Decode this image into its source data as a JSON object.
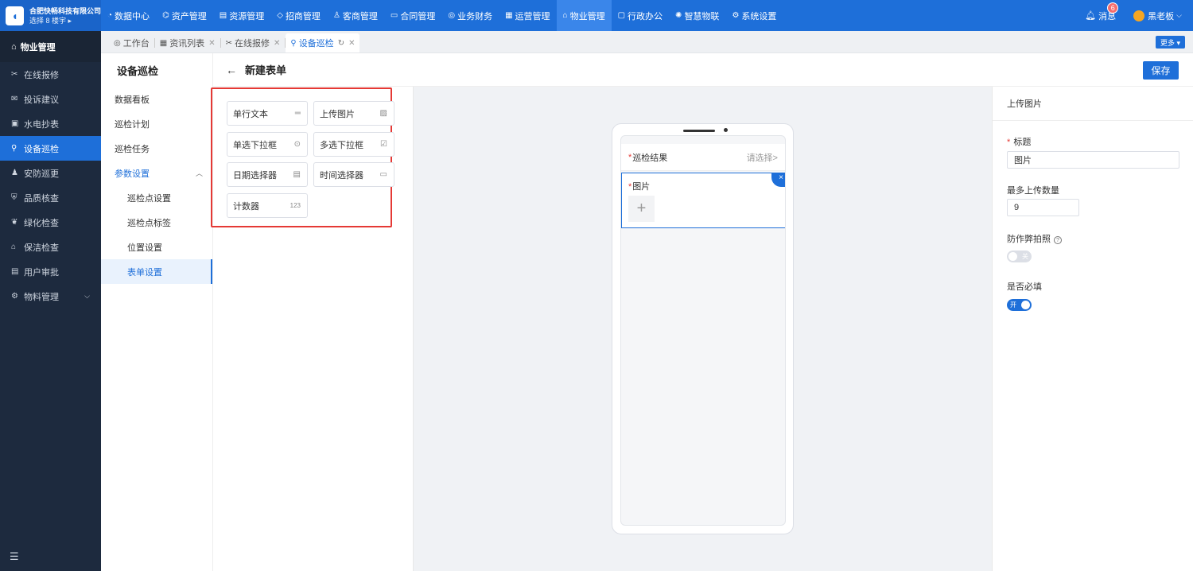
{
  "brand": {
    "name": "合肥快畅科技有限公司",
    "sub": "选择 8 楼宇 ▸",
    "logo_icon": "whale-logo"
  },
  "nav": [
    {
      "label": "数据中心",
      "icon": "◔"
    },
    {
      "label": "资产管理",
      "icon": "⌬"
    },
    {
      "label": "资源管理",
      "icon": "▤"
    },
    {
      "label": "招商管理",
      "icon": "◇"
    },
    {
      "label": "客商管理",
      "icon": "♙"
    },
    {
      "label": "合同管理",
      "icon": "▭"
    },
    {
      "label": "业务财务",
      "icon": "◎"
    },
    {
      "label": "运营管理",
      "icon": "▦"
    },
    {
      "label": "物业管理",
      "icon": "⌂"
    },
    {
      "label": "行政办公",
      "icon": "▢"
    },
    {
      "label": "智慧物联",
      "icon": "✺"
    },
    {
      "label": "系统设置",
      "icon": "⚙"
    }
  ],
  "top_right": {
    "messages": "消息",
    "badge": "6",
    "user": "黑老板"
  },
  "sidebar": {
    "title": "物业管理",
    "items": [
      {
        "label": "在线报修",
        "icon": "✂"
      },
      {
        "label": "投诉建议",
        "icon": "✉"
      },
      {
        "label": "水电抄表",
        "icon": "▣"
      },
      {
        "label": "设备巡检",
        "icon": "⚲"
      },
      {
        "label": "安防巡更",
        "icon": "♟"
      },
      {
        "label": "品质核查",
        "icon": "⛨"
      },
      {
        "label": "绿化检查",
        "icon": "❦"
      },
      {
        "label": "保洁检查",
        "icon": "⌂"
      },
      {
        "label": "用户审批",
        "icon": "▤"
      },
      {
        "label": "物料管理",
        "icon": "⚙"
      }
    ]
  },
  "tabs": [
    {
      "label": "工作台",
      "icon": "◎"
    },
    {
      "label": "资讯列表",
      "icon": "▦"
    },
    {
      "label": "在线报修",
      "icon": "✂"
    },
    {
      "label": "设备巡检",
      "icon": "⚲"
    }
  ],
  "more_label": "更多 ▾",
  "submenu": {
    "title": "设备巡检",
    "items": [
      "数据看板",
      "巡检计划",
      "巡检任务",
      "参数设置"
    ],
    "children": [
      "巡检点设置",
      "巡检点标签",
      "位置设置",
      "表单设置"
    ]
  },
  "page": {
    "title": "新建表单",
    "save_label": "保存"
  },
  "components": [
    {
      "label": "单行文本",
      "icon": "═"
    },
    {
      "label": "上传图片",
      "icon": "▨"
    },
    {
      "label": "单选下拉框",
      "icon": "⊙"
    },
    {
      "label": "多选下拉框",
      "icon": "☑"
    },
    {
      "label": "日期选择器",
      "icon": "▤"
    },
    {
      "label": "时间选择器",
      "icon": "▭"
    },
    {
      "label": "计数器",
      "icon": "123"
    }
  ],
  "preview": {
    "field1_label": "巡检结果",
    "field1_placeholder": "请选择>",
    "field2_label": "图片",
    "plus": "+",
    "close": "×"
  },
  "props": {
    "title": "上传图片",
    "label_title": "标题",
    "title_value": "图片",
    "label_max": "最多上传数量",
    "max_value": "9",
    "label_anticheat": "防作弊拍照",
    "help": "?",
    "switch_off": "关",
    "label_required": "是否必填",
    "switch_on": "开"
  }
}
